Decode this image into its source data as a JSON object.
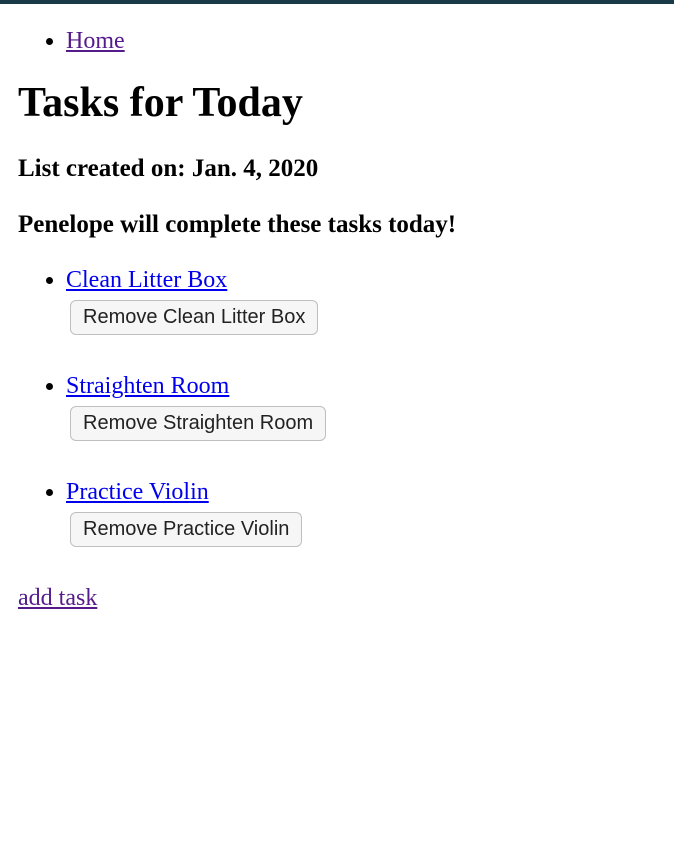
{
  "nav": {
    "home_label": "Home"
  },
  "page": {
    "title": "Tasks for Today",
    "created_on_label": "List created on: Jan. 4, 2020",
    "assignee_text": "Penelope will complete these tasks today!"
  },
  "tasks": {
    "items": [
      {
        "name": "Clean Litter Box",
        "remove_label": "Remove Clean Litter Box"
      },
      {
        "name": "Straighten Room",
        "remove_label": "Remove Straighten Room"
      },
      {
        "name": "Practice Violin",
        "remove_label": "Remove Practice Violin"
      }
    ]
  },
  "footer": {
    "add_task_label": "add task"
  }
}
